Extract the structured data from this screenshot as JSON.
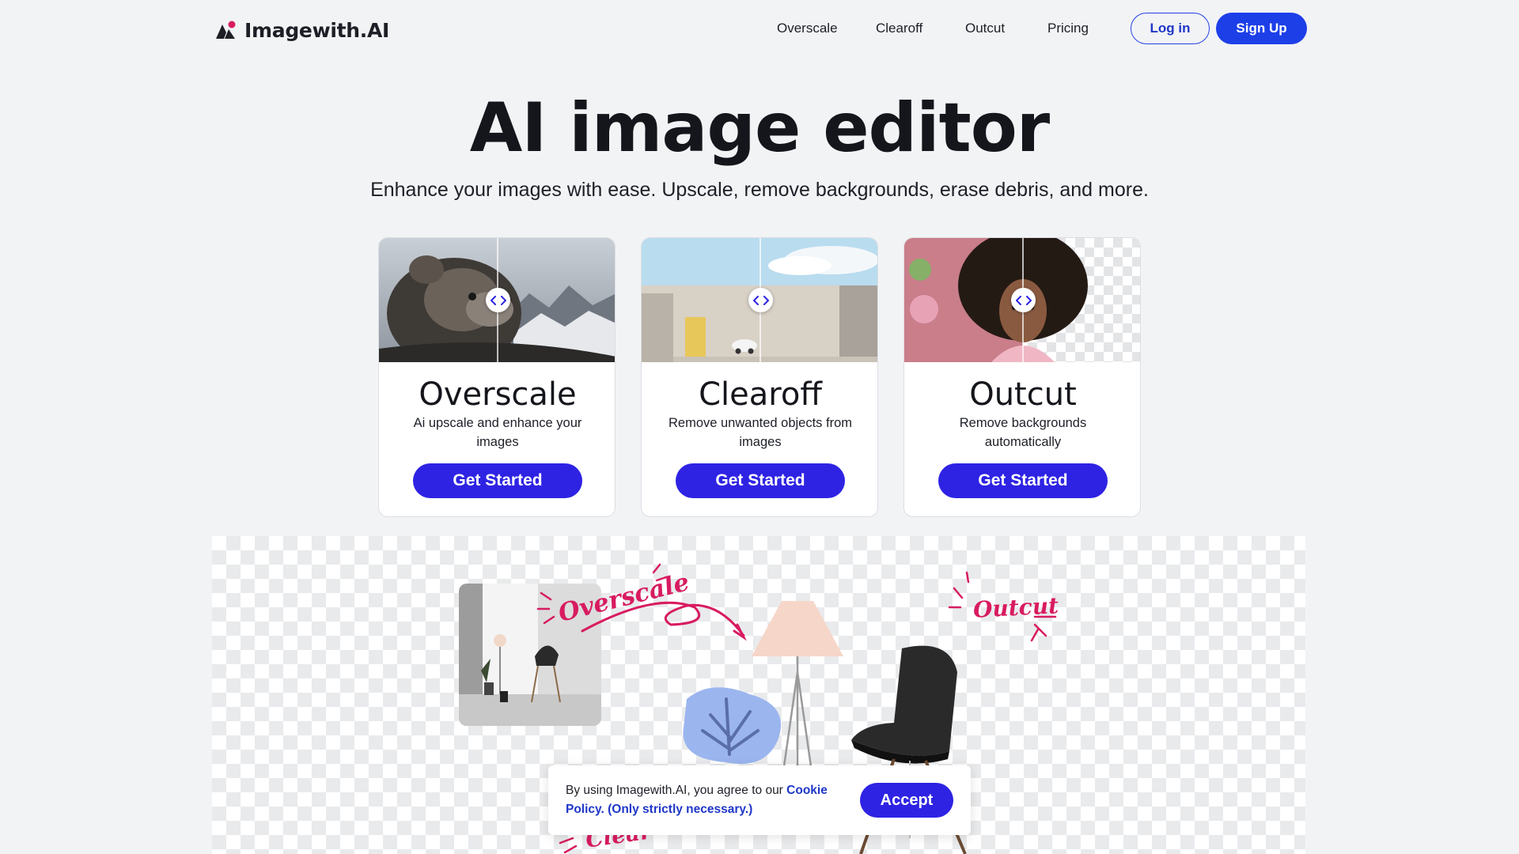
{
  "header": {
    "logo_text": "Imagewith.AI",
    "nav": [
      {
        "label": "Overscale"
      },
      {
        "label": "Clearoff"
      },
      {
        "label": "Outcut"
      },
      {
        "label": "Pricing"
      }
    ],
    "login_label": "Log in",
    "signup_label": "Sign Up"
  },
  "hero": {
    "title": "AI image editor",
    "subtitle": "Enhance your images with ease. Upscale, remove backgrounds, erase debris, and more."
  },
  "cards": [
    {
      "title": "Overscale",
      "description": "Ai upscale and enhance your images",
      "button": "Get Started",
      "handle_icon": "compare-slider-icon"
    },
    {
      "title": "Clearoff",
      "description": "Remove unwanted objects from images",
      "button": "Get Started",
      "handle_icon": "compare-slider-icon"
    },
    {
      "title": "Outcut",
      "description": "Remove backgrounds automatically",
      "button": "Get Started",
      "handle_icon": "compare-slider-icon"
    }
  ],
  "showcase": {
    "label_overscale": "Overscale",
    "label_outcut": "Outcut",
    "label_clearoff": "Clear"
  },
  "cookie": {
    "text_before": "By using Imagewith.AI, you agree to our ",
    "link_text": "Cookie Policy. (Only strictly necessary.)",
    "accept_label": "Accept"
  },
  "colors": {
    "primary": "#2e23e3",
    "link": "#1f37c8",
    "accent_handwriting": "#d81b60",
    "background": "#f2f3f5"
  }
}
